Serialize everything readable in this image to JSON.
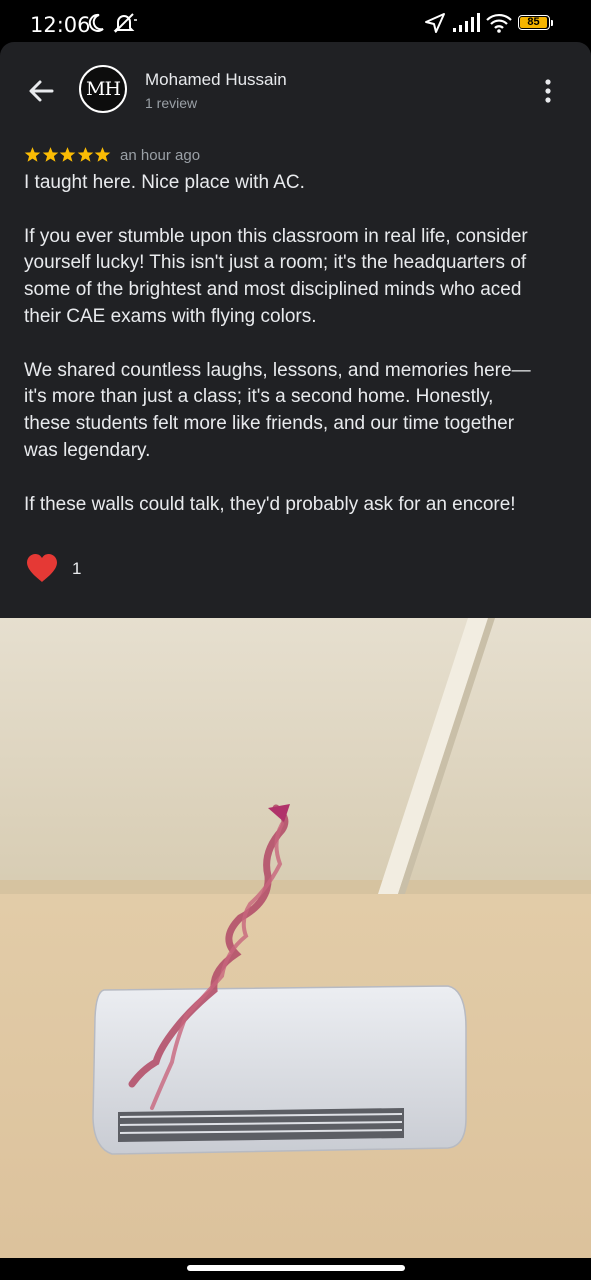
{
  "status_bar": {
    "time": "12:06",
    "battery": "85",
    "icons": [
      "moon-icon",
      "muted-bell-icon",
      "location-arrow-icon",
      "signal-icon",
      "wifi-icon",
      "battery-icon"
    ]
  },
  "review": {
    "author_initials": "MH",
    "author_name": "Mohamed Hussain",
    "author_subtitle": "1 review",
    "rating": 5,
    "time_ago": "an hour ago",
    "paragraphs": [
      "I taught here. Nice place with AC.",
      "If you ever stumble upon this classroom in real life, consider\nyourself lucky! This isn't just a room; it's the headquarters of\nsome of the brightest and most disciplined minds who aced\ntheir CAE exams with flying colors.",
      "We shared countless laughs, lessons, and memories here—\nit's more than just a class; it's a second home. Honestly,\nthese students felt more like friends, and our time together\nwas legendary.",
      "If these walls could talk, they'd probably ask for an encore!"
    ],
    "reaction_count": "1"
  },
  "colors": {
    "sheet_bg": "#202124",
    "star": "#fbbc04",
    "heart": "#e53935",
    "secondary_text": "#9aa0a6"
  }
}
